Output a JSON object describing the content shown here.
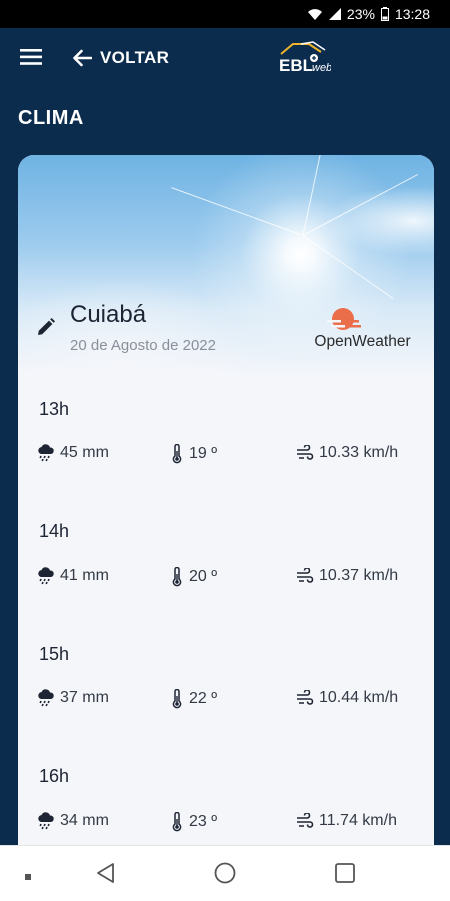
{
  "status_bar": {
    "battery": "23%",
    "time": "13:28"
  },
  "app_bar": {
    "back_label": "VOLTAR",
    "logo_text": "EBL",
    "logo_suffix": "web"
  },
  "page": {
    "title": "CLIMA"
  },
  "location": {
    "city": "Cuiabá",
    "date": "20 de Agosto de 2022",
    "provider": "OpenWeather"
  },
  "forecast": [
    {
      "hour": "13h",
      "rain": "45 mm",
      "temp": "19 º",
      "wind": "10.33 km/h"
    },
    {
      "hour": "14h",
      "rain": "41 mm",
      "temp": "20 º",
      "wind": "10.37 km/h"
    },
    {
      "hour": "15h",
      "rain": "37 mm",
      "temp": "22 º",
      "wind": "10.44 km/h"
    },
    {
      "hour": "16h",
      "rain": "34 mm",
      "temp": "23 º",
      "wind": "11.74 km/h"
    }
  ],
  "colors": {
    "primary": "#0c2c4e",
    "card": "#f4f6fa",
    "openweather": "#eb6e4b"
  },
  "icons": [
    "menu-icon",
    "arrow-left-icon",
    "pencil-icon",
    "rain-cloud-icon",
    "thermometer-icon",
    "wind-icon"
  ]
}
